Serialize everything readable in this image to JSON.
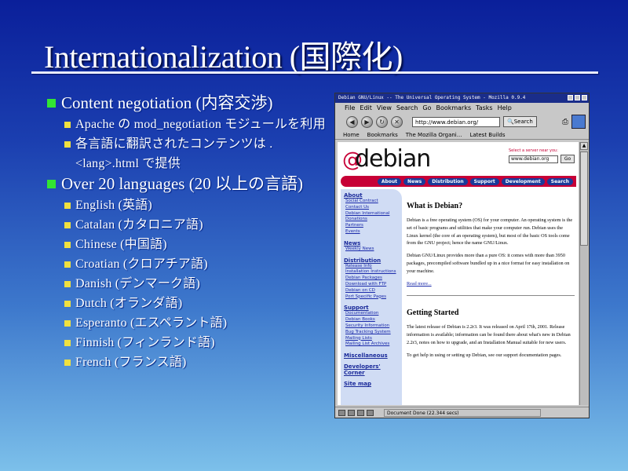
{
  "slide": {
    "title": "Internationalization (国際化)",
    "bullets": [
      {
        "text": "Content negotiation (内容交渉)",
        "children": [
          "Apache の mod_negotiation モジュールを利用",
          "各言語に翻訳されたコンテンツは .<lang>.html で提供"
        ]
      },
      {
        "text": "Over 20 languages (20 以上の言語)",
        "children": [
          "English (英語)",
          "Catalan (カタロニア語)",
          "Chinese (中国語)",
          "Croatian (クロアチア語)",
          "Danish (デンマーク語)",
          "Dutch (オランダ語)",
          "Esperanto (エスペラント語)",
          "Finnish (フィンランド語)",
          "French (フランス語)"
        ]
      }
    ],
    "colors": {
      "bullet1": "#32e632",
      "bullet2": "#f0e040"
    }
  },
  "browser": {
    "window_title": "Debian GNU/Linux -- The Universal Operating System - Mozilla 0.9.4",
    "menu": [
      "File",
      "Edit",
      "View",
      "Search",
      "Go",
      "Bookmarks",
      "Tasks",
      "Help"
    ],
    "url": "http://www.debian.org/",
    "search_label": "Search",
    "personal_bar": [
      "Home",
      "Bookmarks",
      "The Mozilla Organi...",
      "Latest Builds"
    ],
    "status": "Document Done (22.344 secs)",
    "page": {
      "logo": "debian",
      "mirror_label": "Select a server near you:",
      "mirror_value": "www.debian.org",
      "go_label": "Go",
      "nav": [
        "About",
        "News",
        "Distribution",
        "Support",
        "Development",
        "Search"
      ],
      "sidebar": [
        {
          "heading": "About",
          "links": [
            "Social Contract",
            "Contact Us",
            "Debian International",
            "Donations",
            "Partners",
            "Events"
          ]
        },
        {
          "heading": "News",
          "links": [
            "Weekly News"
          ]
        },
        {
          "heading": "Distribution",
          "links": [
            "Release Info",
            "Installation Instructions",
            "Debian Packages",
            "Download with FTP",
            "Debian on CD",
            "Port Specific Pages"
          ]
        },
        {
          "heading": "Support",
          "links": [
            "Documentation",
            "Debian Books",
            "Security Information",
            "Bug Tracking System",
            "Mailing Lists",
            "Mailing List Archives"
          ]
        },
        {
          "heading": "Miscellaneous",
          "links": []
        },
        {
          "heading": "Developers' Corner",
          "links": []
        },
        {
          "heading": "Site map",
          "links": []
        }
      ],
      "h_what": "What is Debian?",
      "p1": "Debian is a free operating system (OS) for your computer. An operating system is the set of basic programs and utilities that make your computer run. Debian uses the Linux kernel (the core of an operating system), but most of the basic OS tools come from the GNU project; hence the name GNU/Linux.",
      "p2": "Debian GNU/Linux provides more than a pure OS: it comes with more than 3950 packages, precompiled software bundled up in a nice format for easy installation on your machine.",
      "read_more": "Read more...",
      "h_started": "Getting Started",
      "p3": "The latest release of Debian is 2.2r3. It was released on April 17th, 2001. Release information is available; information can be found there about what's new in Debian 2.2r3, notes on how to upgrade, and an Installation Manual suitable for new users.",
      "p4": "To get help in using or setting up Debian, see our support documentation pages."
    },
    "colors": {
      "titlebar": "#1a2d8a",
      "debian_red": "#c70036",
      "nav_blue": "#1a3a9a",
      "sidebar_bg": "#d0dcf4"
    }
  }
}
